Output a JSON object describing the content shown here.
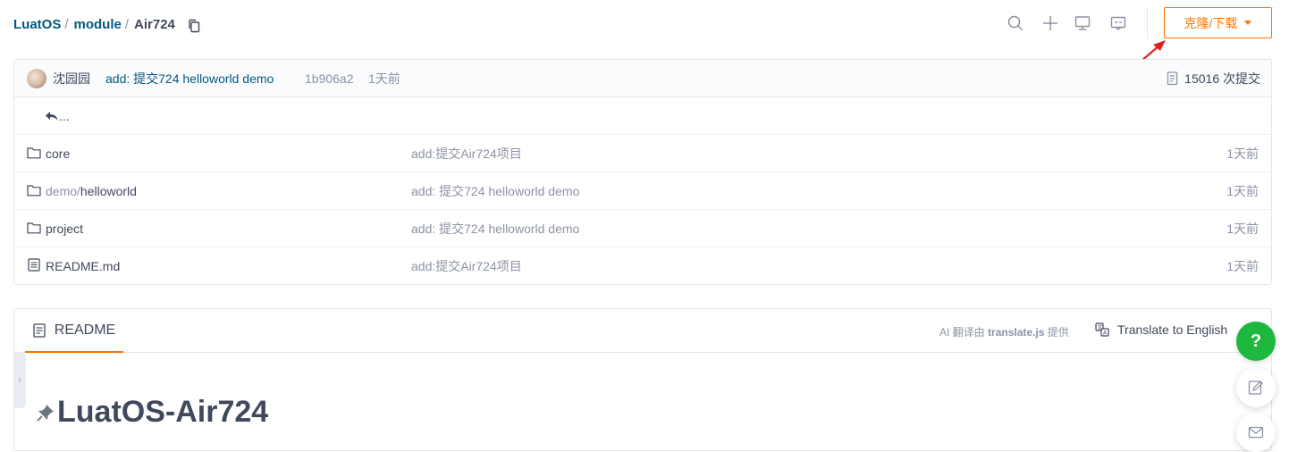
{
  "breadcrumb": {
    "items": [
      "LuatOS",
      "module"
    ],
    "current": "Air724",
    "separator": "/"
  },
  "toolbar": {
    "clone_label": "克隆/下载",
    "icons": [
      "search-icon",
      "plus-icon",
      "monitor-icon",
      "comment-icon"
    ]
  },
  "commit": {
    "author": "沈园园",
    "message": "add: 提交724 helloworld demo",
    "sha": "1b906a2",
    "time": "1天前",
    "count": "15016 次提交"
  },
  "files": {
    "back_label": "...",
    "rows": [
      {
        "type": "folder",
        "name_dim": "",
        "name": "core",
        "message": "add:提交Air724项目",
        "time": "1天前"
      },
      {
        "type": "folder",
        "name_dim": "demo/",
        "name": "helloworld",
        "message": "add: 提交724 helloworld demo",
        "time": "1天前"
      },
      {
        "type": "folder",
        "name_dim": "",
        "name": "project",
        "message": "add: 提交724 helloworld demo",
        "time": "1天前"
      },
      {
        "type": "file",
        "name_dim": "",
        "name": "README.md",
        "message": "add:提交Air724项目",
        "time": "1天前"
      }
    ]
  },
  "readme": {
    "tab_label": "README",
    "translate_prefix": "AI 翻译由",
    "translate_lib": "translate.js",
    "translate_suffix": "提供",
    "translate_link": "Translate to English",
    "title": "LuatOS-Air724"
  },
  "floating": {
    "help_label": "?"
  },
  "colors": {
    "accent": "#fe7300",
    "link": "#005980",
    "help": "#1fb83e",
    "annotation": "#e02020"
  }
}
